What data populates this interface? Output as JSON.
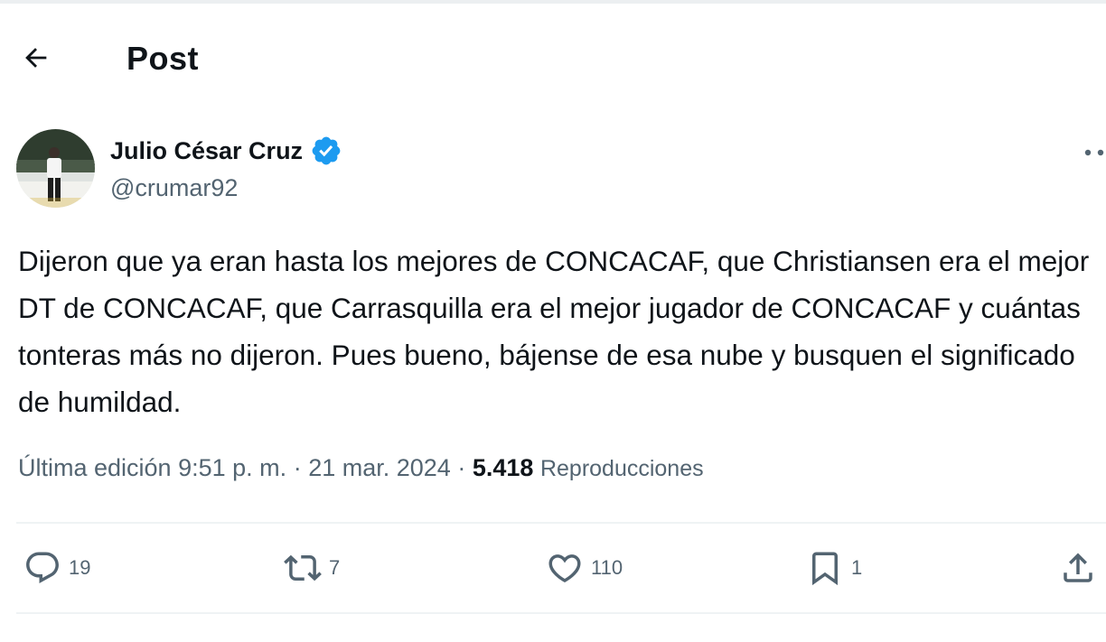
{
  "header": {
    "title": "Post",
    "back_icon": "arrow-left-icon"
  },
  "author": {
    "display_name": "Julio César Cruz",
    "handle": "@crumar92",
    "verified": true,
    "verified_color": "#1d9bf0"
  },
  "tweet": {
    "text": "Dijeron que ya eran hasta los mejores de CONCACAF, que Christiansen era el mejor DT de CONCACAF, que Carrasquilla era el mejor jugador de CONCACAF y cuántas tonteras más no dijeron. Pues bueno, bájense de esa nube y busquen el significado de humildad."
  },
  "meta": {
    "edited_label": "Última edición",
    "time": "9:51 p. m.",
    "separator": "·",
    "date": "21 mar. 2024",
    "views_count": "5.418",
    "views_label": "Reproducciones"
  },
  "actions": {
    "replies": "19",
    "reposts": "7",
    "likes": "110",
    "bookmarks": "1"
  },
  "colors": {
    "text": "#0f1419",
    "secondary": "#536471",
    "accent": "#1d9bf0"
  }
}
